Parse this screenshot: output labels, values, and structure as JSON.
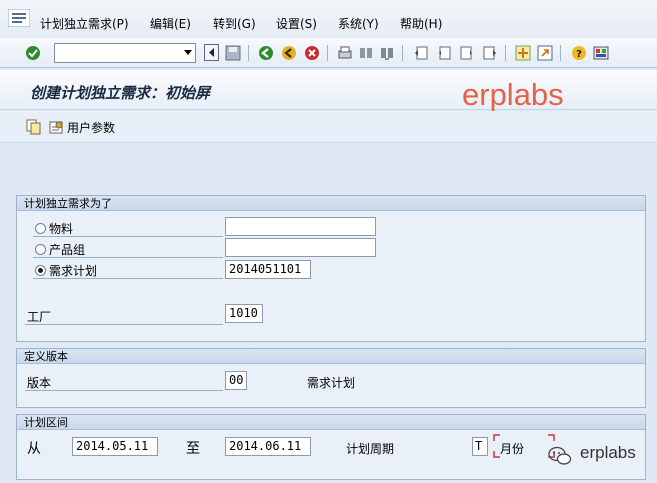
{
  "menu": {
    "items": [
      "计划独立需求(P)",
      "编辑(E)",
      "转到(G)",
      "设置(S)",
      "系统(Y)",
      "帮助(H)"
    ]
  },
  "toolbar": {
    "command_value": "",
    "icons": [
      "enter-icon",
      "back-icon",
      "exit-icon",
      "cancel-icon",
      "print-icon",
      "find-icon",
      "find-next-icon",
      "first-page-icon",
      "prev-page-icon",
      "next-page-icon",
      "last-page-icon",
      "new-session-icon",
      "shortcut-icon",
      "help-icon",
      "customize-layout-icon"
    ]
  },
  "title": "创建计划独立需求：初始屏",
  "watermark": "erplabs",
  "app_toolbar": {
    "user_params_label": "用户参数"
  },
  "group_requirements": {
    "title": "计划独立需求为了",
    "options": [
      {
        "label": "物料",
        "selected": false,
        "value": ""
      },
      {
        "label": "产品组",
        "selected": false,
        "value": ""
      },
      {
        "label": "需求计划",
        "selected": true,
        "value": "2014051101"
      }
    ],
    "plant_label": "工厂",
    "plant_value": "1010"
  },
  "group_version": {
    "title": "定义版本",
    "version_label": "版本",
    "version_value": "00",
    "version_desc": "需求计划"
  },
  "group_period": {
    "title": "计划区间",
    "from_label": "从",
    "from_value": "2014.05.11",
    "to_label": "至",
    "to_value": "2014.06.11",
    "period_label": "计划周期",
    "period_value": "T",
    "period_desc": "月份"
  },
  "watermark_bottom": "erplabs"
}
